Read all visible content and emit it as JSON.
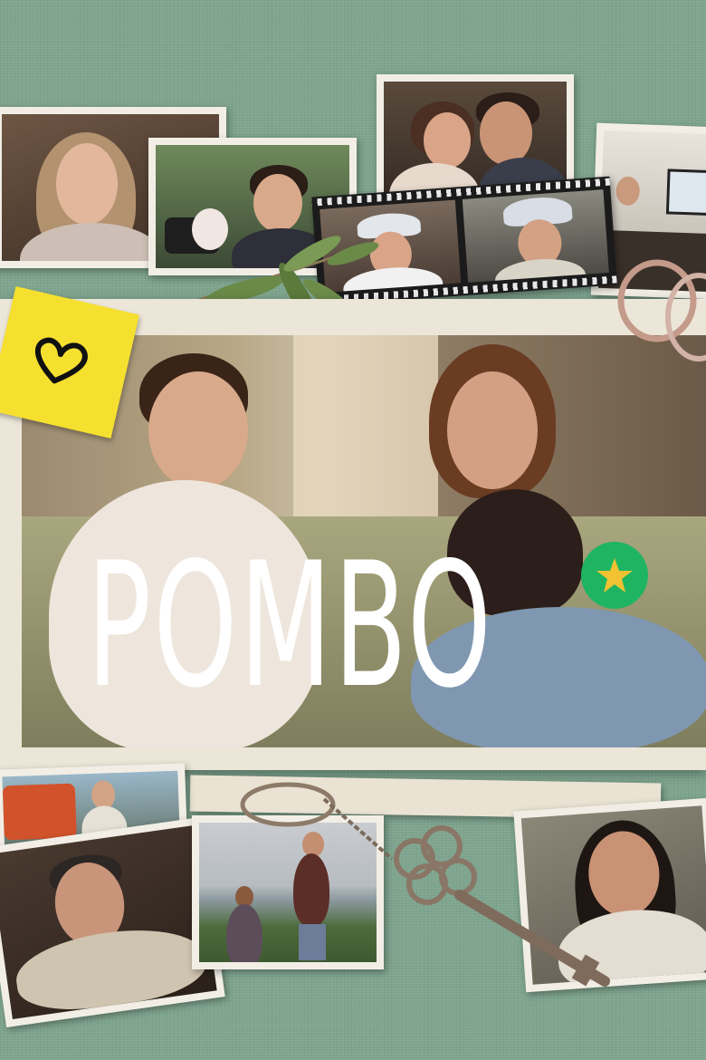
{
  "poster": {
    "title": "POMBO",
    "badge_icon": "star-icon",
    "sticky_note_icon": "heart-icon"
  },
  "colors": {
    "background": "#7fa58f",
    "title": "#ffffff",
    "badge": "#1fb462",
    "sticky_note": "#f6e02f"
  }
}
